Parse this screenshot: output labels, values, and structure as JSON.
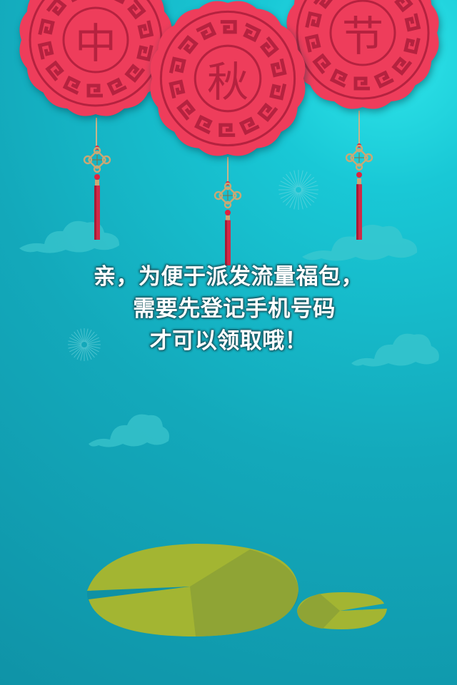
{
  "badges": [
    "中",
    "秋",
    "节"
  ],
  "message": {
    "line1": "亲，为便于派发流量福包，",
    "line2": "需要先登记手机号码",
    "line3": "才可以领取哦！"
  },
  "colors": {
    "background": "#13a9bb",
    "badge_red": "#ee3d5b",
    "badge_pattern": "#b5223f",
    "lily_pad": "#a3b532",
    "text": "#ffffff"
  },
  "icons": [
    "chinese-knot-icon",
    "tassel-icon",
    "cloud-icon",
    "firework-icon",
    "lily-pad-icon"
  ]
}
